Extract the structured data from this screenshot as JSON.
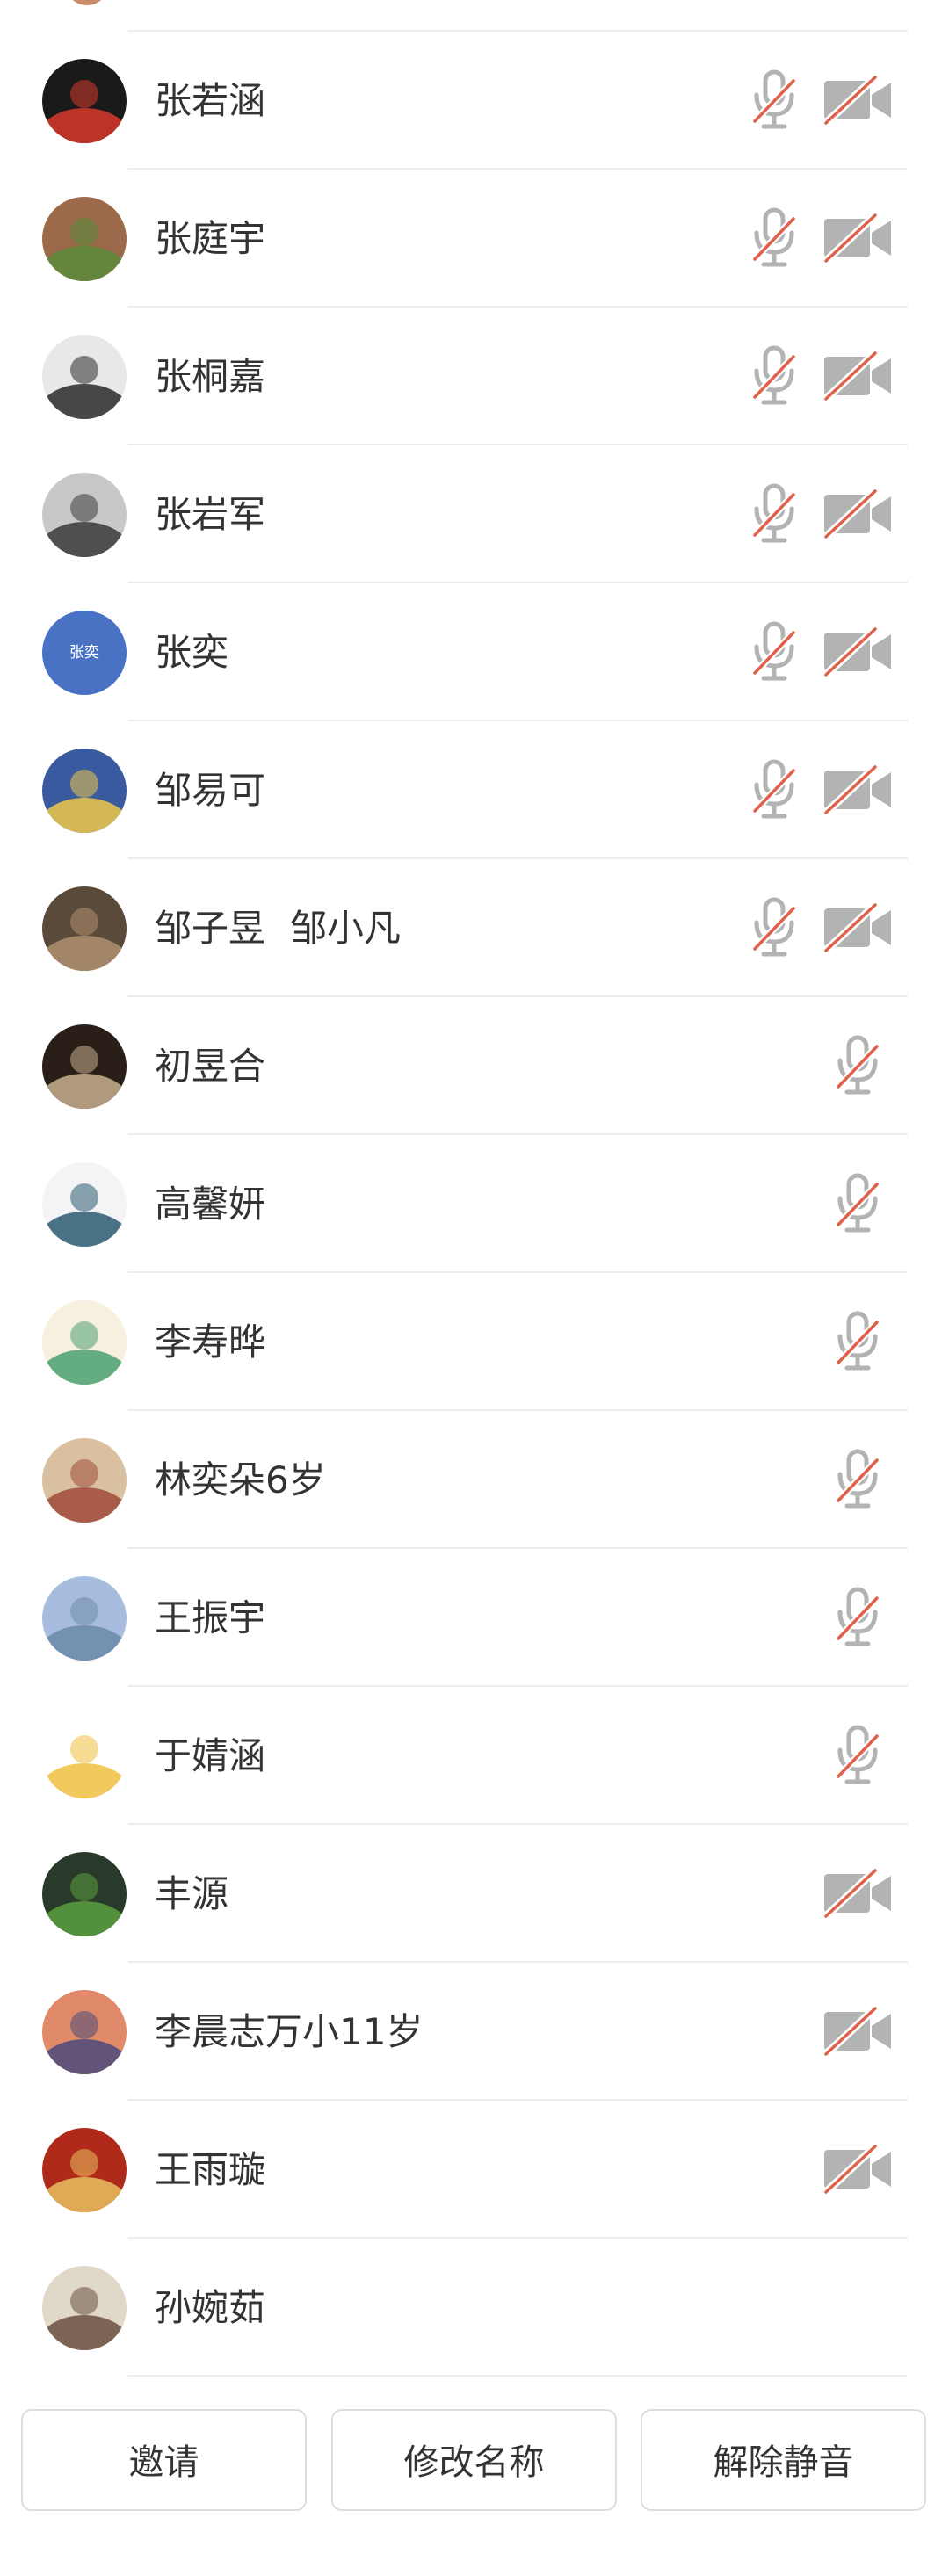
{
  "participants": [
    {
      "name": "张若涵",
      "sub": "",
      "mic_muted": true,
      "cam_off": true,
      "avatar": {
        "type": "image",
        "colors": [
          "#1a1a1a",
          "#d83a2a"
        ],
        "desc": "panda-mascots-icon"
      }
    },
    {
      "name": "张庭宇",
      "sub": "",
      "mic_muted": true,
      "cam_off": true,
      "avatar": {
        "type": "image",
        "colors": [
          "#9a6a4a",
          "#5a8a3a"
        ],
        "desc": "garden-photo-icon"
      }
    },
    {
      "name": "张桐嘉",
      "sub": "",
      "mic_muted": true,
      "cam_off": true,
      "avatar": {
        "type": "image",
        "colors": [
          "#e8e8e8",
          "#2a2a2a"
        ],
        "desc": "person-photo-icon"
      }
    },
    {
      "name": "张岩军",
      "sub": "",
      "mic_muted": true,
      "cam_off": true,
      "avatar": {
        "type": "image",
        "colors": [
          "#c8c8c8",
          "#3a3a3a"
        ],
        "desc": "cat-photo-icon"
      }
    },
    {
      "name": "张奕",
      "sub": "",
      "mic_muted": true,
      "cam_off": true,
      "avatar": {
        "type": "text",
        "text": "张奕",
        "colors": [
          "#4a72c4",
          "#4a72c4"
        ]
      }
    },
    {
      "name": "邹易可",
      "sub": "",
      "mic_muted": true,
      "cam_off": true,
      "avatar": {
        "type": "image",
        "colors": [
          "#3a5aa0",
          "#f0c84a"
        ],
        "desc": "astronaut-cartoon-icon"
      }
    },
    {
      "name": "邹子昱",
      "sub": "邹小凡",
      "mic_muted": true,
      "cam_off": true,
      "avatar": {
        "type": "image",
        "colors": [
          "#5a4a3a",
          "#b09070"
        ],
        "desc": "cat-photo-icon"
      }
    },
    {
      "name": "初昱合",
      "sub": "",
      "mic_muted": true,
      "cam_off": false,
      "avatar": {
        "type": "image",
        "colors": [
          "#2a1e18",
          "#c8b090"
        ],
        "desc": "person-photo-icon"
      }
    },
    {
      "name": "高馨妍",
      "sub": "",
      "mic_muted": true,
      "cam_off": false,
      "avatar": {
        "type": "image",
        "colors": [
          "#f4f4f6",
          "#2a5a70"
        ],
        "desc": "person-photo-icon"
      }
    },
    {
      "name": "李寿晔",
      "sub": "",
      "mic_muted": true,
      "cam_off": false,
      "avatar": {
        "type": "image",
        "colors": [
          "#f6f0e0",
          "#4aa070"
        ],
        "desc": "girl-cartoon-icon"
      }
    },
    {
      "name": "林奕朵6岁",
      "sub": "",
      "mic_muted": true,
      "cam_off": false,
      "avatar": {
        "type": "image",
        "colors": [
          "#d8c0a0",
          "#a04a3a"
        ],
        "desc": "cartoon-illustration-icon"
      }
    },
    {
      "name": "王振宇",
      "sub": "",
      "mic_muted": true,
      "cam_off": false,
      "avatar": {
        "type": "image",
        "colors": [
          "#a8bce0",
          "#6a8aa8"
        ],
        "desc": "seaside-photo-icon"
      }
    },
    {
      "name": "于婧涵",
      "sub": "",
      "mic_muted": true,
      "cam_off": false,
      "avatar": {
        "type": "image",
        "colors": [
          "#ffffff",
          "#f0c040"
        ],
        "desc": "girl-cartoon-icon"
      }
    },
    {
      "name": "丰源",
      "sub": "",
      "mic_muted": false,
      "cam_off": true,
      "avatar": {
        "type": "image",
        "colors": [
          "#2a3a2a",
          "#5aa040"
        ],
        "desc": "plant-pot-photo-icon"
      }
    },
    {
      "name": "李晨志万小11岁",
      "sub": "",
      "mic_muted": false,
      "cam_off": true,
      "avatar": {
        "type": "image",
        "colors": [
          "#e08a6a",
          "#4a4a7a"
        ],
        "desc": "sunset-photo-icon"
      }
    },
    {
      "name": "王雨璇",
      "sub": "",
      "mic_muted": false,
      "cam_off": true,
      "avatar": {
        "type": "image",
        "colors": [
          "#b02a1a",
          "#e8c060"
        ],
        "desc": "cartoon-illustration-icon"
      }
    },
    {
      "name": "孙婉茹",
      "sub": "",
      "mic_muted": false,
      "cam_off": false,
      "avatar": {
        "type": "image",
        "colors": [
          "#e0d8c8",
          "#6a5040"
        ],
        "desc": "person-photo-icon"
      }
    }
  ],
  "footer": {
    "invite_label": "邀请",
    "rename_label": "修改名称",
    "unmute_label": "解除静音"
  },
  "colors": {
    "icon_gray": "#b3b3b3",
    "slash_red": "#e0604a",
    "separator": "#ececec",
    "text": "#333333"
  }
}
